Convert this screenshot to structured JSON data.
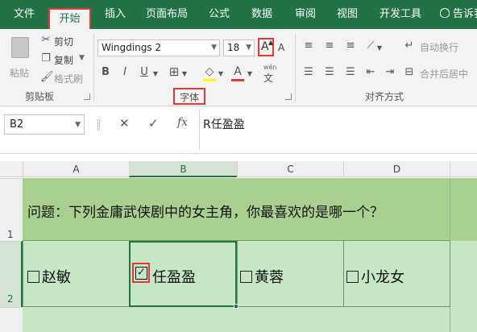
{
  "tabs": [
    "文件",
    "开始",
    "插入",
    "页面布局",
    "公式",
    "数据",
    "审阅",
    "视图",
    "开发工具",
    "告诉我"
  ],
  "ribbon": {
    "clipboard": {
      "paste": "粘贴",
      "cut": "剪切",
      "copy": "复制",
      "format_painter": "格式刷",
      "label": "剪贴板"
    },
    "font": {
      "name": "Wingdings 2",
      "size": "18",
      "grow": "A",
      "shrink": "A",
      "bold": "B",
      "italic": "I",
      "underline": "U",
      "phonetic_top": "wén",
      "phonetic_bottom": "文",
      "label": "字体"
    },
    "alignment": {
      "wrap": "自动换行",
      "merge": "合并后居中",
      "label": "对齐方式"
    }
  },
  "formula_bar": {
    "name_box": "B2",
    "fx": "fx",
    "content": "R任盈盈"
  },
  "columns": [
    "A",
    "B",
    "C",
    "D"
  ],
  "selected_column": "B",
  "rows": [
    "1",
    "2"
  ],
  "cells": {
    "A1": "问题：下列金庸武侠剧中的女主角，你最喜欢的是哪一个？",
    "A2": "赵敏",
    "B2": "任盈盈",
    "C2": "黄蓉",
    "D2": "小龙女"
  },
  "colors": {
    "accent": "#217346",
    "highlight": "#e53935",
    "row1": "#a9d08e",
    "row2": "#c6e6c6"
  }
}
